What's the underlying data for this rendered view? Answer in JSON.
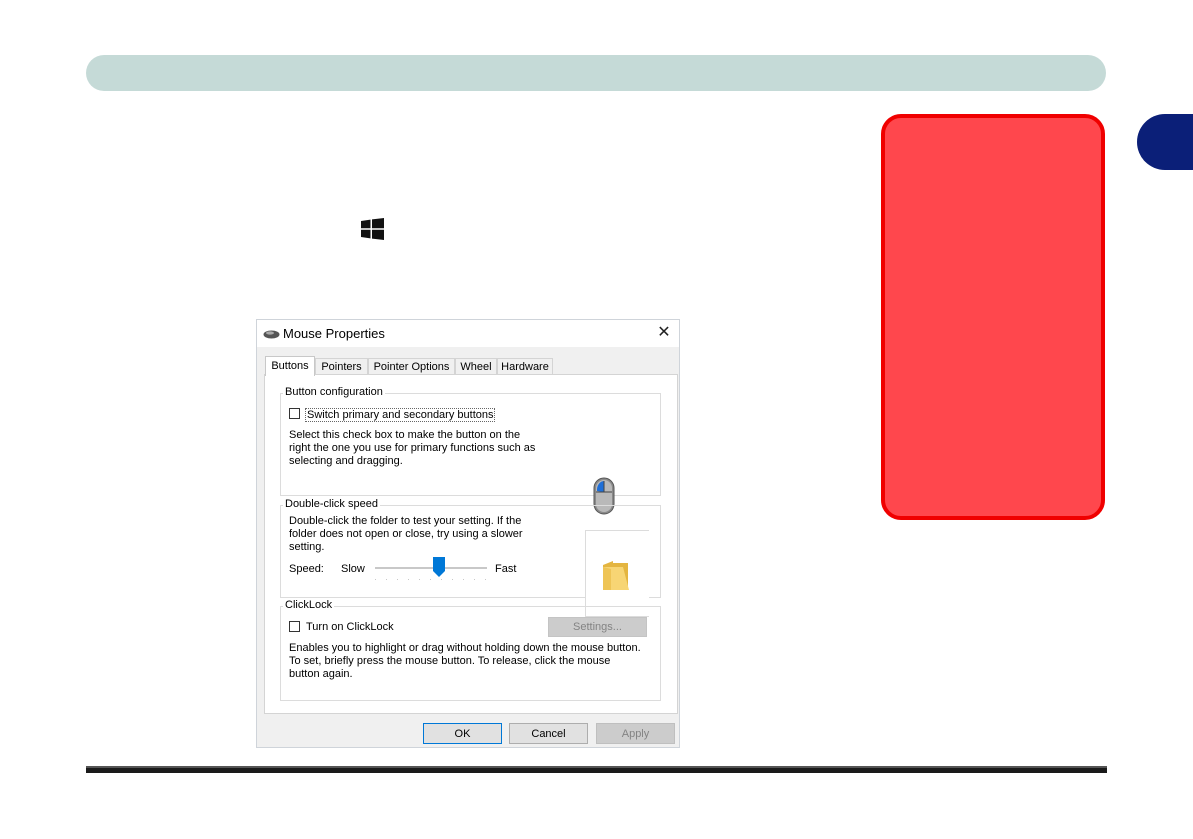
{
  "dialog": {
    "title": "Mouse Properties",
    "close": "✕",
    "tabs": [
      {
        "label": "Buttons"
      },
      {
        "label": "Pointers"
      },
      {
        "label": "Pointer Options"
      },
      {
        "label": "Wheel"
      },
      {
        "label": "Hardware"
      }
    ],
    "active_tab": "Buttons",
    "button_configuration": {
      "group_label": "Button configuration",
      "checkbox_label": "Switch primary and secondary buttons",
      "checked": false,
      "description": [
        "Select this check box to make the button on the",
        "right the one you use for primary functions such as",
        "selecting and dragging."
      ]
    },
    "double_click": {
      "group_label": "Double-click speed",
      "description": [
        "Double-click the folder to test your setting. If the",
        "folder does not open or close, try using a slower",
        "setting."
      ],
      "speed_label": "Speed:",
      "slow_label": "Slow",
      "fast_label": "Fast",
      "speed_value": 0.57
    },
    "clicklock": {
      "group_label": "ClickLock",
      "checkbox_label": "Turn on ClickLock",
      "checked": false,
      "settings_button": "Settings...",
      "description": [
        "Enables you to highlight or drag without holding down the mouse button.",
        "To set, briefly press the mouse button. To release, click the mouse",
        "button again."
      ]
    },
    "buttons": {
      "ok": "OK",
      "cancel": "Cancel",
      "apply": "Apply"
    }
  },
  "page": {
    "chapter_tab_color": "#0b1f78",
    "header_color": "#c5dad7",
    "note_box_color": "#ff474d",
    "windows_icon": "windows-logo-icon"
  }
}
